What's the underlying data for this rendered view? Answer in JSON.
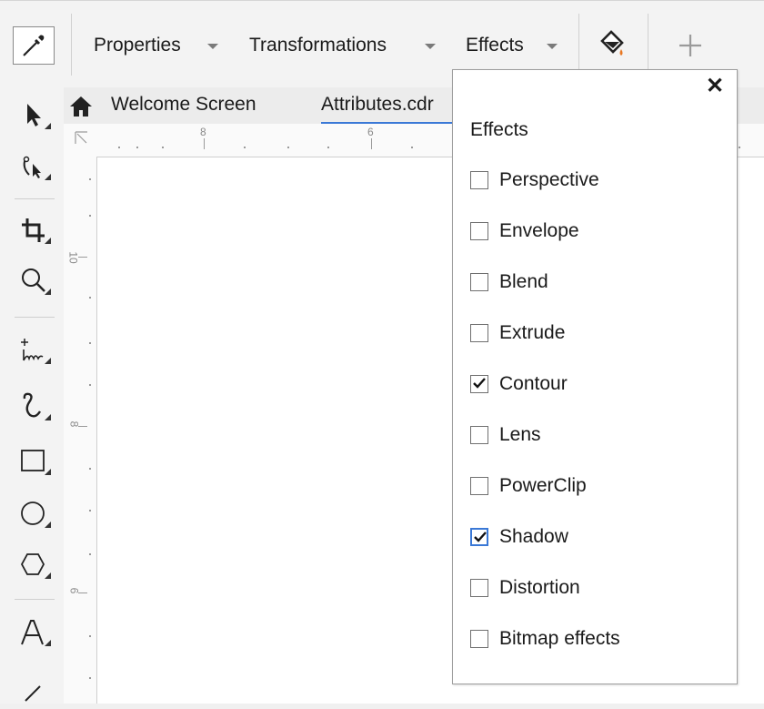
{
  "toolbar": {
    "picker_icon": "eyedropper-icon",
    "menus": [
      {
        "label": "Properties"
      },
      {
        "label": "Transformations"
      },
      {
        "label": "Effects"
      }
    ],
    "fill_icon": "fill-bucket-icon",
    "add_icon": "plus-icon"
  },
  "tabs": {
    "home_icon": "home-icon",
    "items": [
      {
        "label": "Welcome Screen",
        "active": false
      },
      {
        "label": "Attributes.cdr",
        "active": true
      }
    ]
  },
  "ruler": {
    "top_labels": [
      "8",
      "6"
    ],
    "left_labels": [
      "10",
      "8",
      "6"
    ]
  },
  "tools": [
    "pick-tool-icon",
    "shape-tool-icon",
    "crop-tool-icon",
    "zoom-tool-icon",
    "freehand-tool-icon",
    "artistic-media-icon",
    "rectangle-tool-icon",
    "ellipse-tool-icon",
    "polygon-tool-icon",
    "text-tool-icon",
    "line-tool-icon"
  ],
  "effects_panel": {
    "title": "Effects",
    "close_glyph": "✕",
    "items": [
      {
        "label": "Perspective",
        "checked": false
      },
      {
        "label": "Envelope",
        "checked": false
      },
      {
        "label": "Blend",
        "checked": false
      },
      {
        "label": "Extrude",
        "checked": false
      },
      {
        "label": "Contour",
        "checked": true
      },
      {
        "label": "Lens",
        "checked": false
      },
      {
        "label": "PowerClip",
        "checked": false
      },
      {
        "label": "Shadow",
        "checked": true,
        "focused": true
      },
      {
        "label": "Distortion",
        "checked": false
      },
      {
        "label": "Bitmap effects",
        "checked": false
      }
    ]
  },
  "colors": {
    "accent": "#3a78d6",
    "fill_icon_accent": "#e87722"
  }
}
